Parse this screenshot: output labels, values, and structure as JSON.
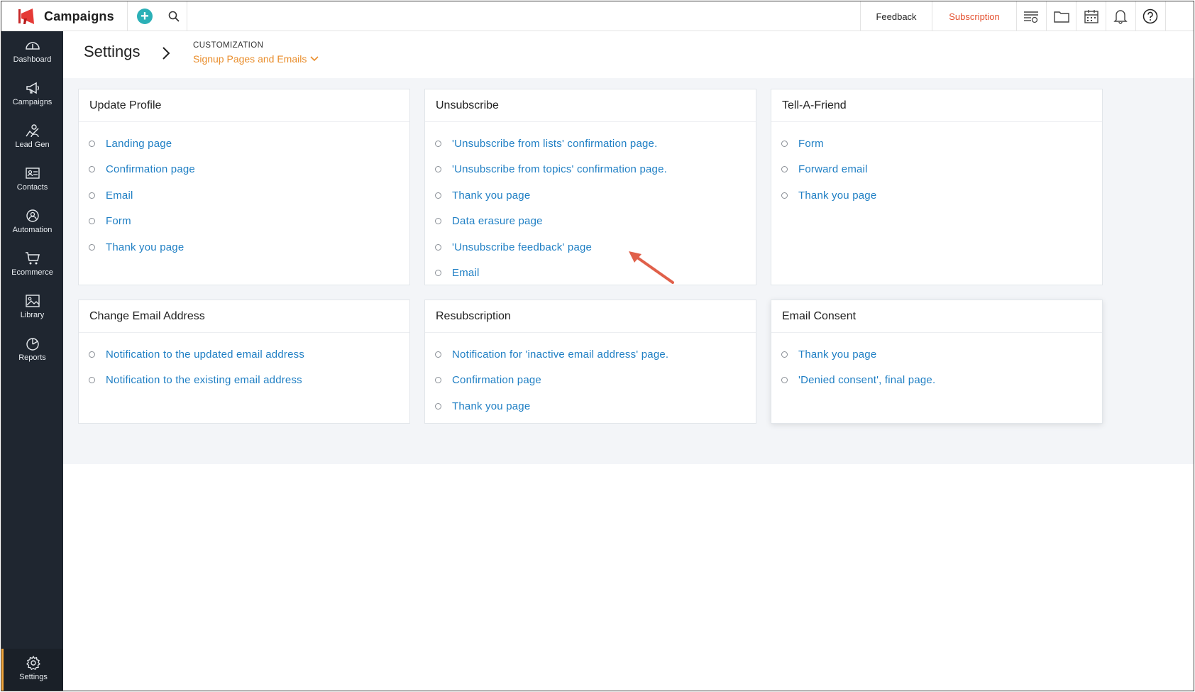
{
  "app": {
    "name": "Campaigns",
    "add_icon": "plus-circle-icon",
    "search_icon": "search-icon"
  },
  "topbar": {
    "feedback": "Feedback",
    "subscription": "Subscription",
    "icons": [
      "list-icon",
      "folder-icon",
      "calendar-icon",
      "bell-icon",
      "help-icon"
    ]
  },
  "sidebar": {
    "items": [
      {
        "label": "Dashboard",
        "icon": "gauge-icon"
      },
      {
        "label": "Campaigns",
        "icon": "megaphone-icon"
      },
      {
        "label": "Lead Gen",
        "icon": "lead-gen-icon"
      },
      {
        "label": "Contacts",
        "icon": "contact-card-icon"
      },
      {
        "label": "Automation",
        "icon": "automation-icon"
      },
      {
        "label": "Ecommerce",
        "icon": "cart-icon"
      },
      {
        "label": "Library",
        "icon": "image-library-icon"
      },
      {
        "label": "Reports",
        "icon": "pie-chart-icon"
      }
    ],
    "settings": {
      "label": "Settings",
      "icon": "gear-icon"
    }
  },
  "header": {
    "title": "Settings",
    "breadcrumb_small": "CUSTOMIZATION",
    "breadcrumb_current": "Signup Pages and Emails"
  },
  "cards": [
    {
      "title": "Update Profile",
      "links": [
        "Landing page",
        "Confirmation page",
        "Email",
        "Form",
        "Thank you page"
      ]
    },
    {
      "title": "Unsubscribe",
      "links": [
        "'Unsubscribe from lists' confirmation page.",
        "'Unsubscribe from topics' confirmation page.",
        "Thank you page",
        "Data erasure page",
        "'Unsubscribe feedback' page",
        "Email"
      ]
    },
    {
      "title": "Tell-A-Friend",
      "links": [
        "Form",
        "Forward email",
        "Thank you page"
      ]
    },
    {
      "title": "Change Email Address",
      "links": [
        "Notification to the updated email address",
        "Notification to the existing email address"
      ]
    },
    {
      "title": "Resubscription",
      "links": [
        "Notification for 'inactive email address' page.",
        "Confirmation page",
        "Thank you page"
      ]
    },
    {
      "title": "Email Consent",
      "links": [
        "Thank you page",
        "'Denied consent', final page."
      ]
    }
  ],
  "colors": {
    "link": "#1f7fc4",
    "accent_orange": "#e98d2b",
    "subscription_red": "#e4502f",
    "sidebar_bg": "#1f2630",
    "annotation_arrow": "#e0604a"
  }
}
